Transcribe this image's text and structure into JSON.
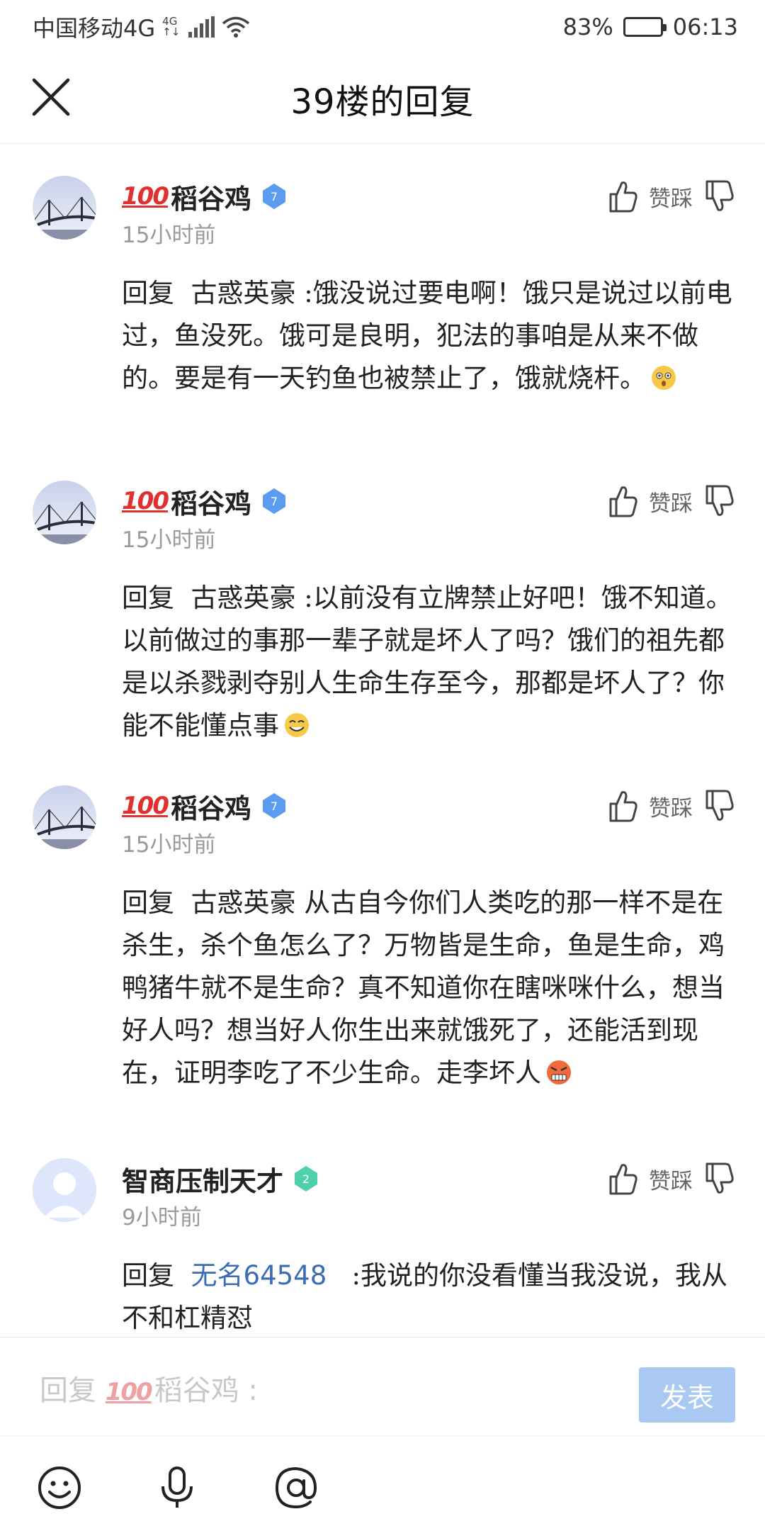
{
  "status_bar": {
    "carrier": "中国移动4G",
    "network_tag_top": "4G",
    "network_tag_bottom": "↑↓",
    "battery_percent": "83%",
    "battery_level": 0.83,
    "time": "06:13"
  },
  "header": {
    "title": "39楼的回复"
  },
  "replies": [
    {
      "name_prefix": "💯",
      "name": "稻谷鸡",
      "level": "7",
      "time": "15小时前",
      "like_label": "赞踩",
      "reply_word": "回复",
      "target": "古惑英豪",
      "text": ":饿没说过要电啊！饿只是说过以前电过，鱼没死。饿可是良明，犯法的事咱是从来不做的。要是有一天钓鱼也被禁止了，饿就烧杆。",
      "emoji": "surprised-face-icon"
    },
    {
      "name_prefix": "💯",
      "name": "稻谷鸡",
      "level": "7",
      "time": "15小时前",
      "like_label": "赞踩",
      "reply_word": "回复",
      "target": "古惑英豪",
      "text": ":以前没有立牌禁止好吧！饿不知道。以前做过的事那一辈子就是坏人了吗？饿们的祖先都是以杀戮剥夺别人生命生存至今，那都是坏人了？你能不能懂点事",
      "emoji": "grin-face-icon"
    },
    {
      "name_prefix": "💯",
      "name": "稻谷鸡",
      "level": "7",
      "time": "15小时前",
      "like_label": "赞踩",
      "reply_word": "回复",
      "target": "古惑英豪",
      "text": "从古自今你们人类吃的那一样不是在杀生，杀个鱼怎么了？万物皆是生命，鱼是生命，鸡鸭猪牛就不是生命？真不知道你在瞎咪咪什么，想当好人吗？想当好人你生出来就饿死了，还能活到现在，证明李吃了不少生命。走李坏人",
      "emoji": "angry-face-icon"
    },
    {
      "name": "智商压制天才",
      "level": "2",
      "time": "9小时前",
      "like_label": "赞踩",
      "reply_word": "回复",
      "target": "无名64548",
      "text": ":我说的你没看懂当我没说，我从不和杠精怼"
    }
  ],
  "reply_input": {
    "prefix": "回复",
    "name_prefix": "💯",
    "name": "稻谷鸡",
    "suffix": ":",
    "send_label": "发表"
  },
  "colors": {
    "accent": "#3a6db5",
    "send_button": "#a9c8f2",
    "level_blue": "#5b9cf0",
    "level_green": "#4fd0a8"
  }
}
